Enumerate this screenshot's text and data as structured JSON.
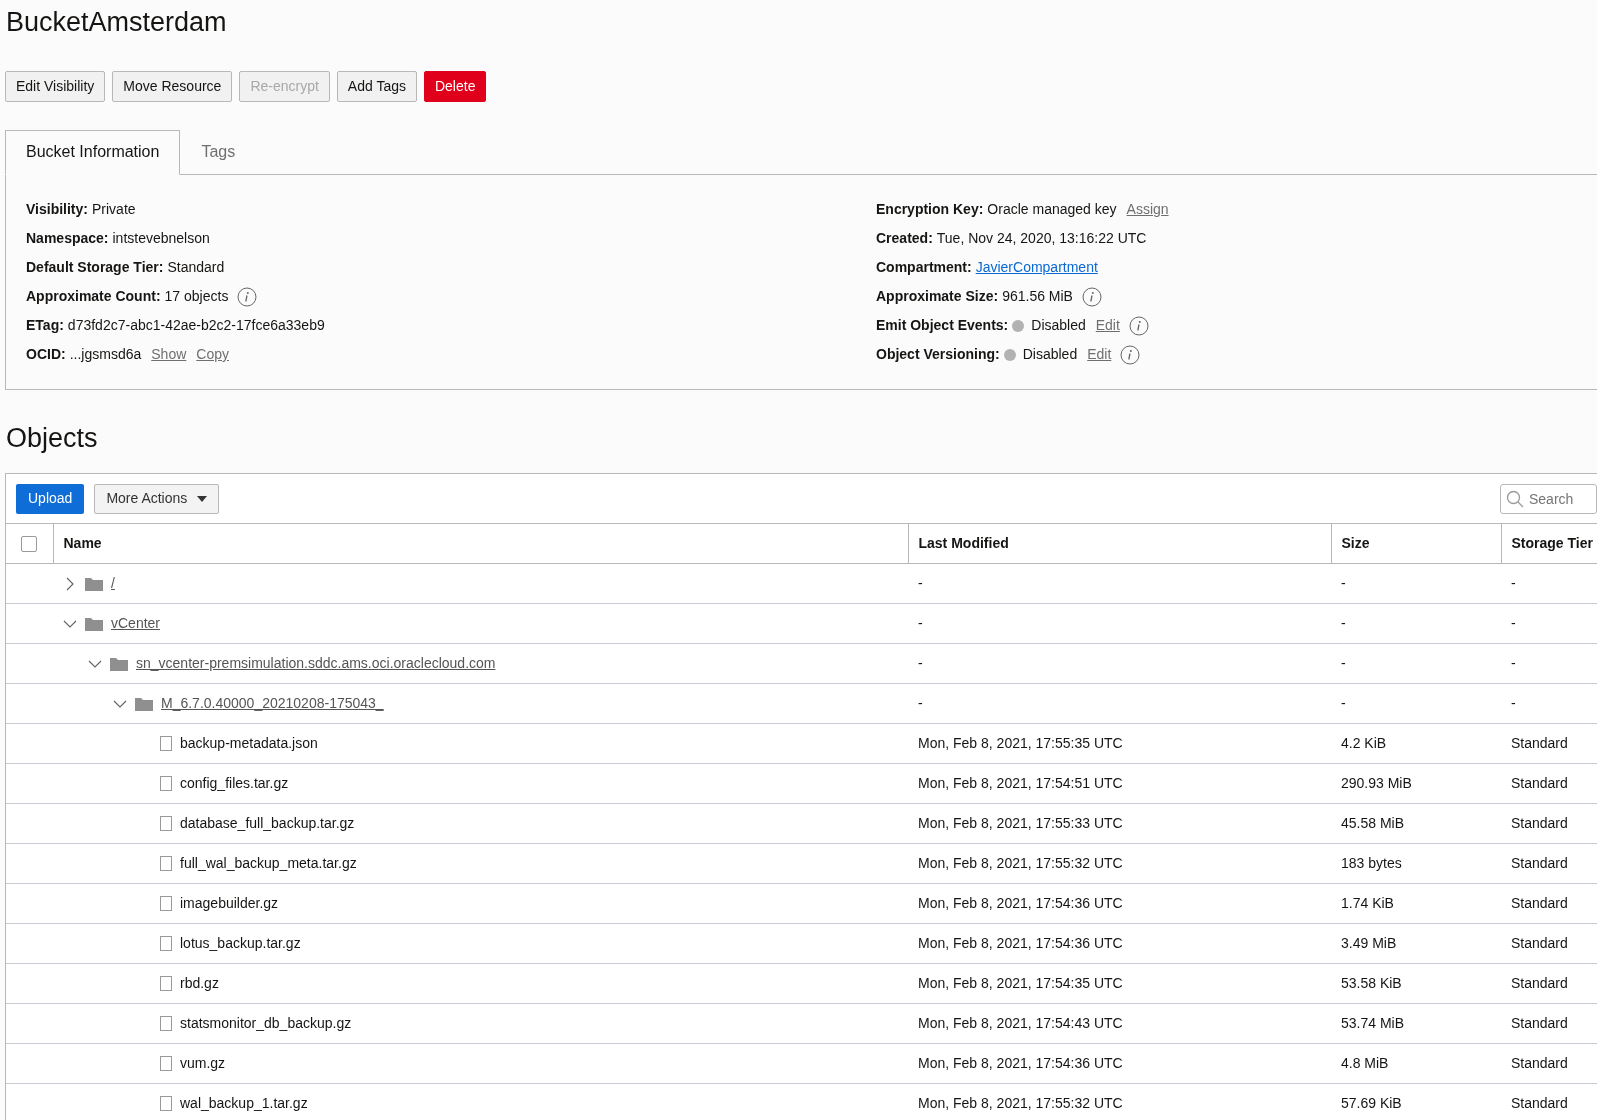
{
  "title": "BucketAmsterdam",
  "actions": [
    {
      "label": "Edit Visibility",
      "kind": "default",
      "disabled": false
    },
    {
      "label": "Move Resource",
      "kind": "default",
      "disabled": false
    },
    {
      "label": "Re-encrypt",
      "kind": "default",
      "disabled": true
    },
    {
      "label": "Add Tags",
      "kind": "default",
      "disabled": false
    },
    {
      "label": "Delete",
      "kind": "danger",
      "disabled": false
    }
  ],
  "tabs": [
    {
      "label": "Bucket Information",
      "selected": true
    },
    {
      "label": "Tags",
      "selected": false
    }
  ],
  "details_left": [
    {
      "label": "Visibility:",
      "value": "Private"
    },
    {
      "label": "Namespace:",
      "value": "intstevebnelson"
    },
    {
      "label": "Default Storage Tier:",
      "value": "Standard"
    },
    {
      "label": "Approximate Count:",
      "value": "17 objects",
      "info": true
    },
    {
      "label": "ETag:",
      "value": "d73fd2c7-abc1-42ae-b2c2-17fce6a33eb9"
    },
    {
      "label": "OCID:",
      "value": "...jgsmsd6a",
      "links": [
        "Show",
        "Copy"
      ]
    }
  ],
  "details_right": [
    {
      "label": "Encryption Key:",
      "value": "Oracle managed key",
      "links": [
        "Assign"
      ]
    },
    {
      "label": "Created:",
      "value": "Tue, Nov 24, 2020, 13:16:22 UTC"
    },
    {
      "label": "Compartment:",
      "link": "JavierCompartment"
    },
    {
      "label": "Approximate Size:",
      "value": "961.56 MiB",
      "info": true
    },
    {
      "label": "Emit Object Events:",
      "on": false,
      "value": "Disabled",
      "links": [
        "Edit"
      ],
      "info": true
    },
    {
      "label": "Object Versioning:",
      "on": false,
      "value": "Disabled",
      "links": [
        "Edit"
      ],
      "info": true
    }
  ],
  "objects": {
    "title": "Objects",
    "upload": "Upload",
    "more_actions": "More Actions",
    "search": {
      "placeholder": "Search"
    },
    "select_all": {
      "checked": false
    },
    "columns": [
      "Name",
      "Last Modified",
      "Size",
      "Storage Tier"
    ],
    "rows": [
      {
        "kind": "folder",
        "name": "/",
        "expanded": false,
        "last_modified": "-",
        "size": "-",
        "storage_tier": "-"
      },
      {
        "kind": "folder",
        "name": "vCenter",
        "expanded": true,
        "last_modified": "-",
        "size": "-",
        "storage_tier": "-",
        "children": [
          {
            "kind": "folder",
            "name": "sn_vcenter-premsimulation.sddc.ams.oci.oraclecloud.com",
            "expanded": true,
            "last_modified": "-",
            "size": "-",
            "storage_tier": "-",
            "children": [
              {
                "kind": "folder",
                "name": "M_6.7.0.40000_20210208-175043_",
                "expanded": true,
                "last_modified": "-",
                "size": "-",
                "storage_tier": "-",
                "children": [
                  {
                    "kind": "file",
                    "name": "backup-metadata.json",
                    "last_modified": "Mon, Feb 8, 2021, 17:55:35 UTC",
                    "size": "4.2 KiB",
                    "storage_tier": "Standard"
                  },
                  {
                    "kind": "file",
                    "name": "config_files.tar.gz",
                    "last_modified": "Mon, Feb 8, 2021, 17:54:51 UTC",
                    "size": "290.93 MiB",
                    "storage_tier": "Standard"
                  },
                  {
                    "kind": "file",
                    "name": "database_full_backup.tar.gz",
                    "last_modified": "Mon, Feb 8, 2021, 17:55:33 UTC",
                    "size": "45.58 MiB",
                    "storage_tier": "Standard"
                  },
                  {
                    "kind": "file",
                    "name": "full_wal_backup_meta.tar.gz",
                    "last_modified": "Mon, Feb 8, 2021, 17:55:32 UTC",
                    "size": "183 bytes",
                    "storage_tier": "Standard"
                  },
                  {
                    "kind": "file",
                    "name": "imagebuilder.gz",
                    "last_modified": "Mon, Feb 8, 2021, 17:54:36 UTC",
                    "size": "1.74 KiB",
                    "storage_tier": "Standard"
                  },
                  {
                    "kind": "file",
                    "name": "lotus_backup.tar.gz",
                    "last_modified": "Mon, Feb 8, 2021, 17:54:36 UTC",
                    "size": "3.49 MiB",
                    "storage_tier": "Standard"
                  },
                  {
                    "kind": "file",
                    "name": "rbd.gz",
                    "last_modified": "Mon, Feb 8, 2021, 17:54:35 UTC",
                    "size": "53.58 KiB",
                    "storage_tier": "Standard"
                  },
                  {
                    "kind": "file",
                    "name": "statsmonitor_db_backup.gz",
                    "last_modified": "Mon, Feb 8, 2021, 17:54:43 UTC",
                    "size": "53.74 MiB",
                    "storage_tier": "Standard"
                  },
                  {
                    "kind": "file",
                    "name": "vum.gz",
                    "last_modified": "Mon, Feb 8, 2021, 17:54:36 UTC",
                    "size": "4.8 MiB",
                    "storage_tier": "Standard"
                  },
                  {
                    "kind": "file",
                    "name": "wal_backup_1.tar.gz",
                    "last_modified": "Mon, Feb 8, 2021, 17:55:32 UTC",
                    "size": "57.69 KiB",
                    "storage_tier": "Standard"
                  }
                ]
              }
            ]
          }
        ]
      }
    ]
  }
}
